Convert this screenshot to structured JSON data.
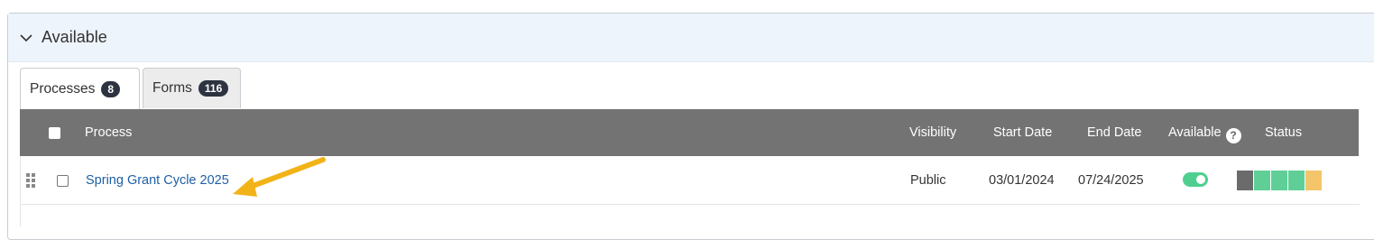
{
  "section": {
    "title": "Available",
    "icon": "chevron-down-icon"
  },
  "tabs": [
    {
      "label": "Processes",
      "count": "8",
      "active": true
    },
    {
      "label": "Forms",
      "count": "116",
      "active": false
    }
  ],
  "table": {
    "headers": {
      "process": "Process",
      "visibility": "Visibility",
      "start_date": "Start Date",
      "end_date": "End Date",
      "available": "Available",
      "status": "Status"
    },
    "help_icon": "?",
    "rows": [
      {
        "process": "Spring Grant Cycle 2025",
        "visibility": "Public",
        "start_date": "03/01/2024",
        "end_date": "07/24/2025",
        "available": true,
        "status_colors": [
          "#6b6b6b",
          "#5fcf97",
          "#5fcf97",
          "#5fcf97",
          "#f4c56a"
        ]
      }
    ]
  },
  "colors": {
    "header_bg": "#737373",
    "link": "#1f5fa6",
    "toggle_on": "#4fcf8f",
    "arrow": "#f2b318",
    "badge_bg": "#2d3340"
  }
}
